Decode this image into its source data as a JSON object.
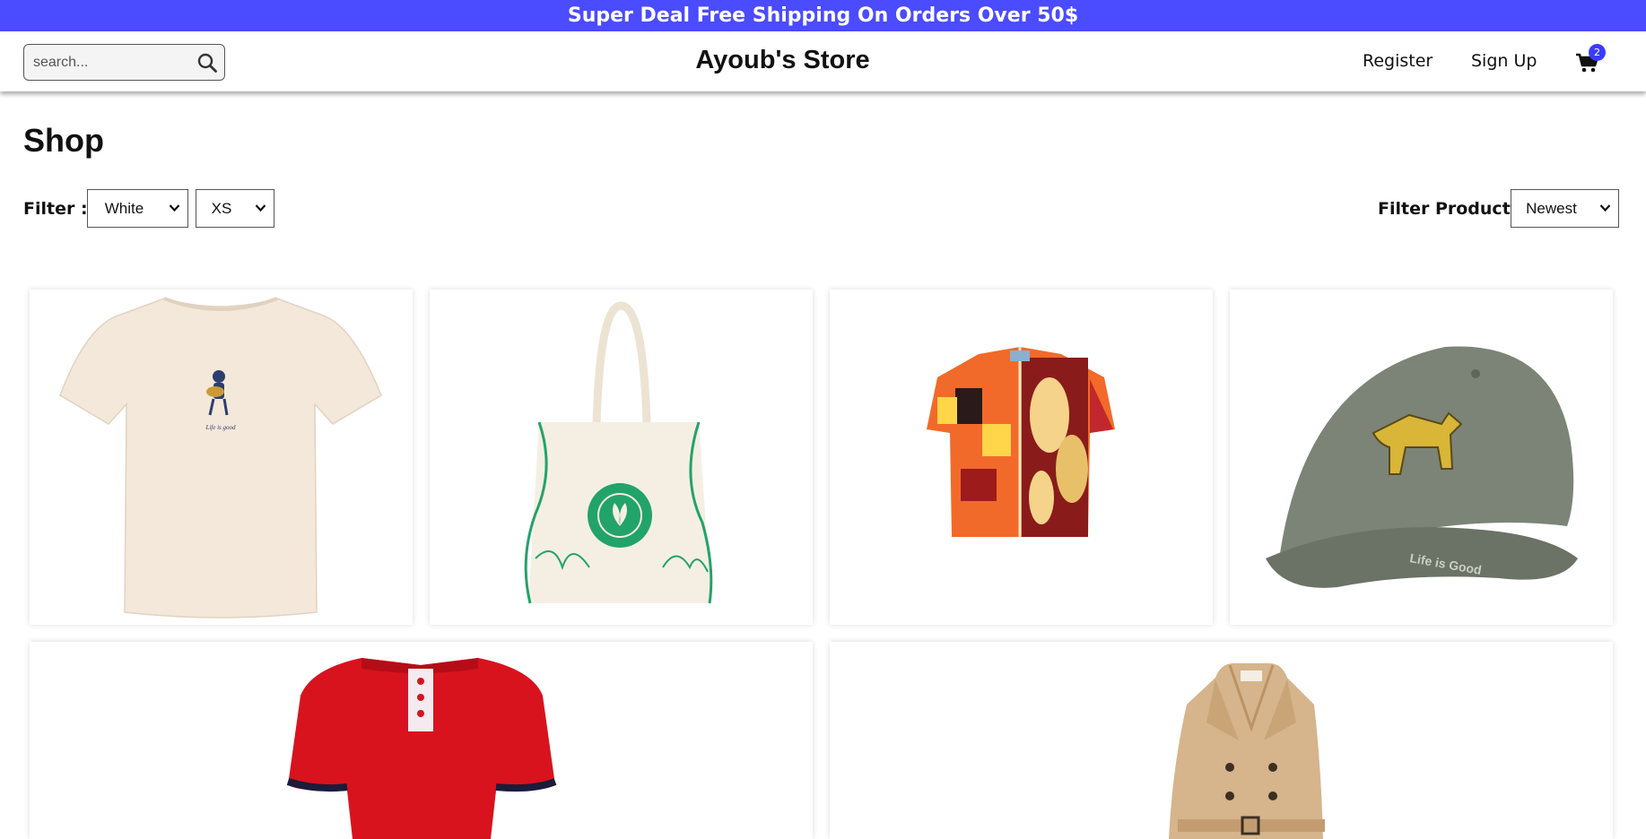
{
  "announcement": "Super Deal Free Shipping On Orders Over 50$",
  "search": {
    "placeholder": "search..."
  },
  "brand": "Ayoub's Store",
  "nav": {
    "register": "Register",
    "signup": "Sign Up",
    "cart_count": "2"
  },
  "page_title": "Shop",
  "filters": {
    "label": "Filter :",
    "color": "White",
    "size": "XS",
    "sort_label": "Filter Products:",
    "sort": "Newest"
  },
  "products": [
    {
      "image": "cream-tshirt"
    },
    {
      "image": "eco-tote-bag"
    },
    {
      "image": "patterned-shirt"
    },
    {
      "image": "grey-cap"
    },
    {
      "image": "red-polo"
    },
    {
      "image": "beige-trench-coat"
    }
  ],
  "colors": {
    "accent": "#4b4bff",
    "badge": "#3b3bff"
  }
}
